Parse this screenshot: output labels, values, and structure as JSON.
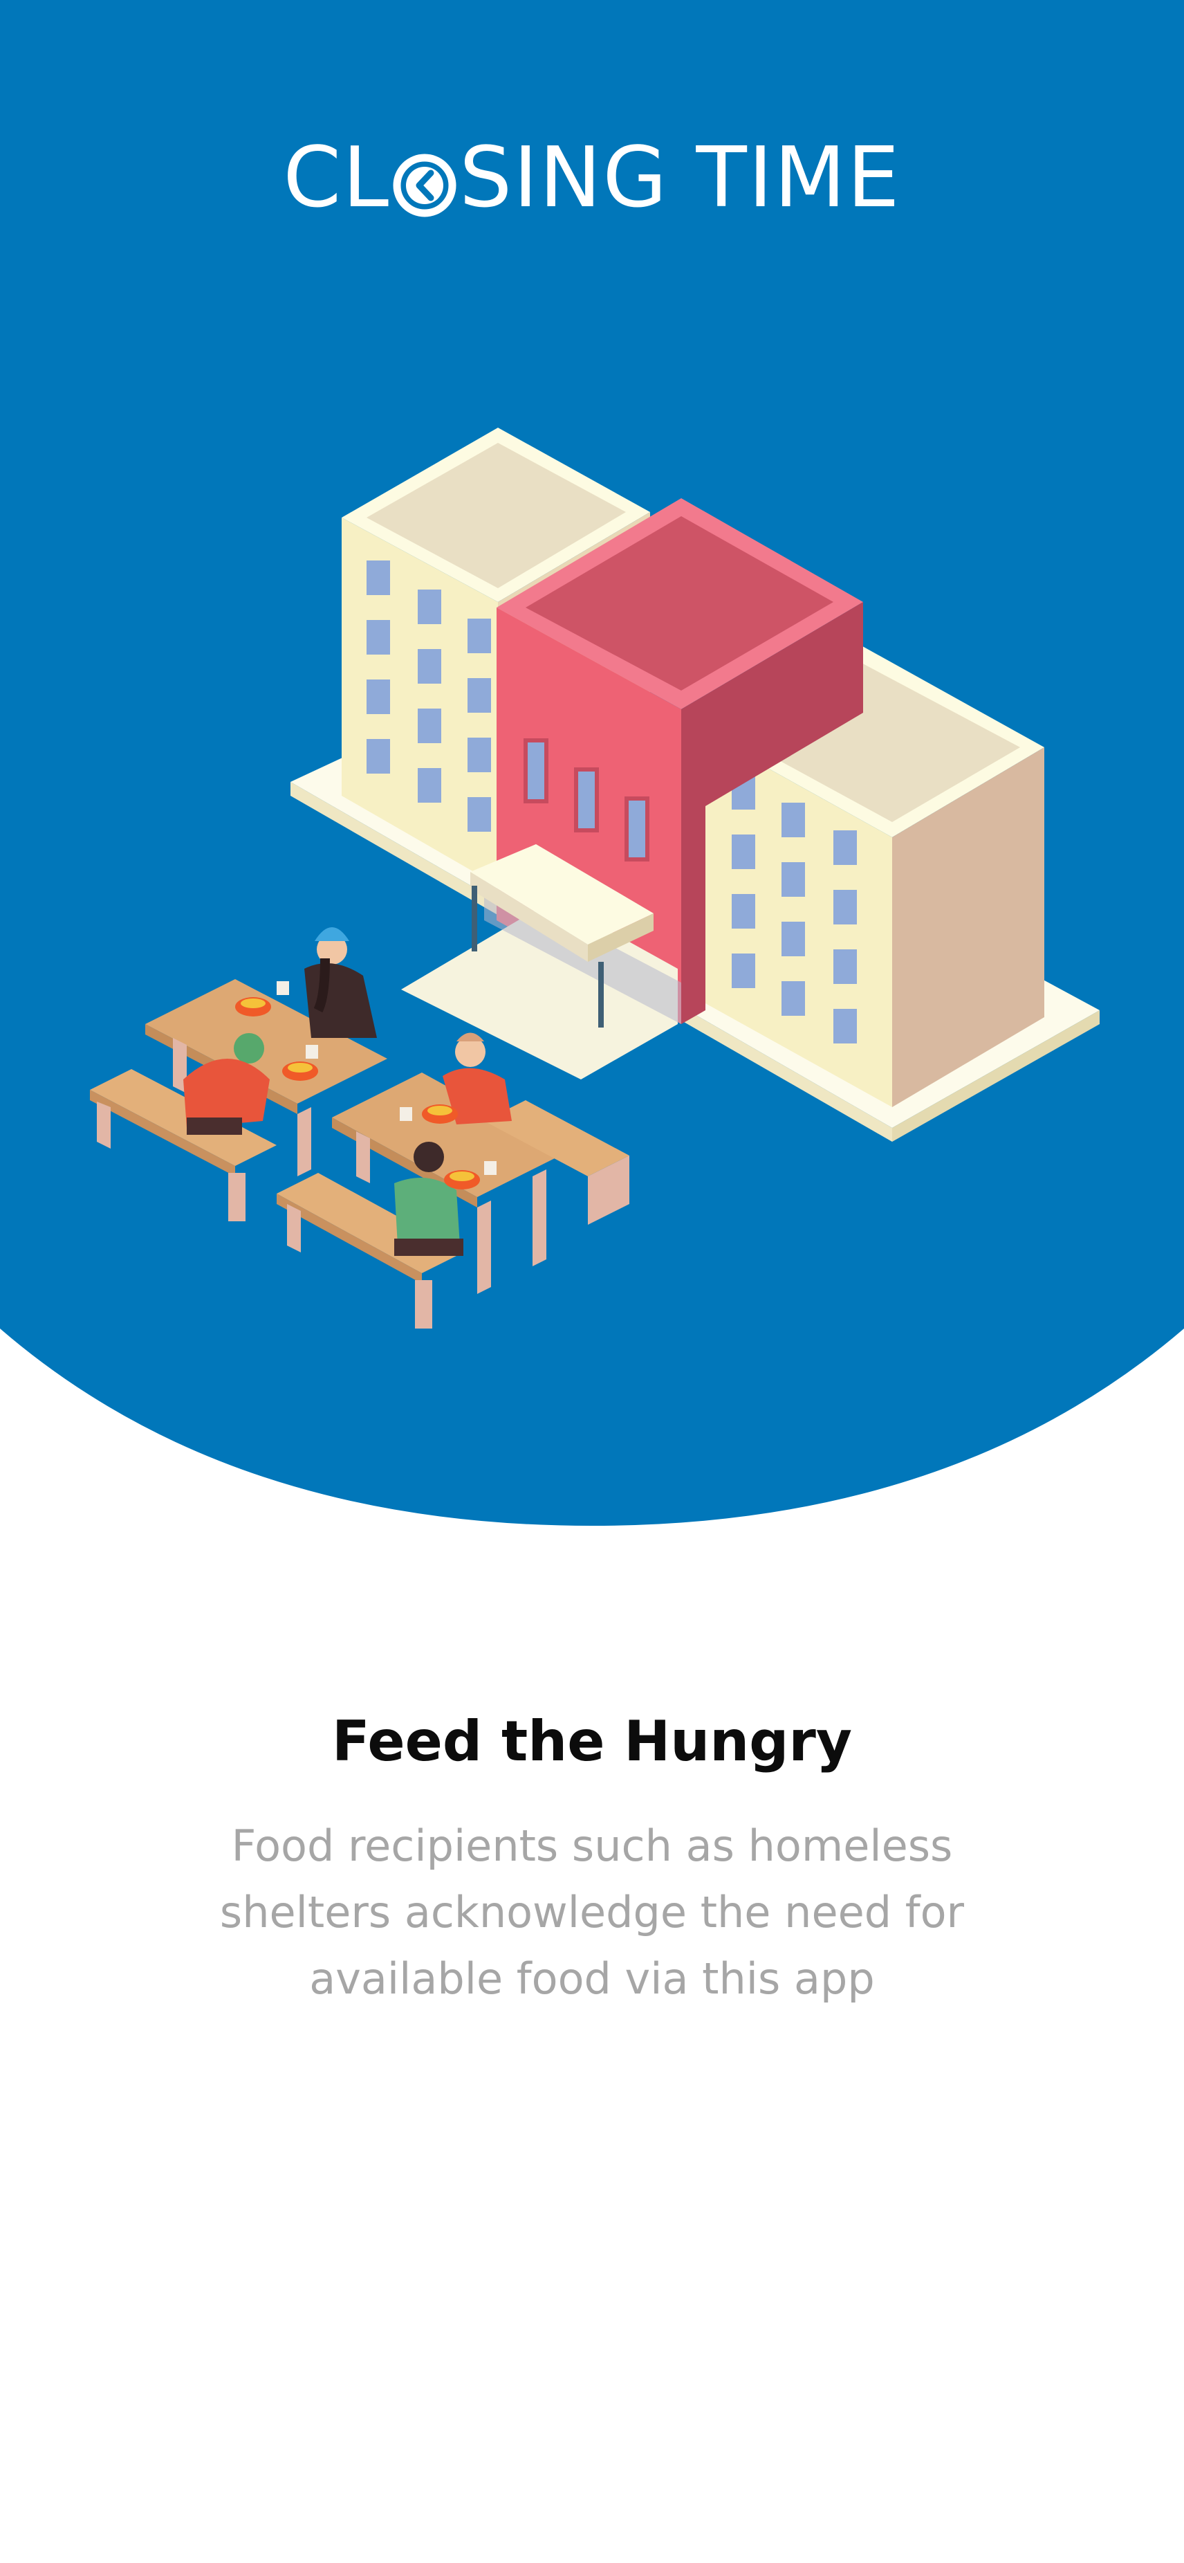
{
  "brand": {
    "name_part1": "CL",
    "name_part2": "SING TIME",
    "logo_icon": "clock-o-icon",
    "primary_color": "#0177BA"
  },
  "onboarding": {
    "illustration": "food-shelter-illustration",
    "title": "Feed the Hungry",
    "description": "Food recipients such as homeless shelters acknowledge the need for available food via this app"
  }
}
